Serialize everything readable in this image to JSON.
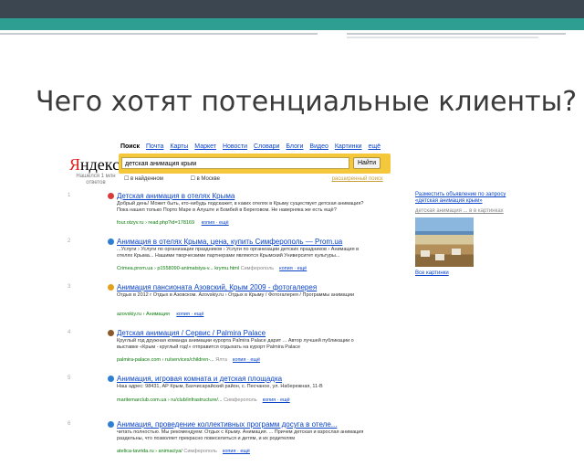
{
  "slide_title": "Чего хотят потенциальные клиенты?",
  "yandex": {
    "logo": "Яндекс",
    "found": "Нашёлся 1 млн ответов",
    "services": [
      "Поиск",
      "Почта",
      "Карты",
      "Маркет",
      "Новости",
      "Словари",
      "Блоги",
      "Видео",
      "Картинки",
      "ещё"
    ],
    "query": "детская анимация крым",
    "search_button": "Найти",
    "option1": "в найденном",
    "option2": "в Москве",
    "advanced": "расширенный поиск"
  },
  "results": [
    {
      "num": "1",
      "title": "Детская анимация в отелях Крыма",
      "snippet": "Добрый день! Может быть, кто-нибудь подскажет, в каких отелях в Крыму существует детская анимация? Пока нашел только Порто Маре в Алуште и Бомбей в Береговом. Не наверняка же есть ещё?",
      "url": "four.otzyv.ru › read.php?id=178169",
      "links": "копия · ещё",
      "fav": "#d83b3b"
    },
    {
      "num": "2",
      "title": "Анимация в отелях Крыма, цена, купить Симферополь — Prom.ua",
      "snippet": "...Услуги › Услуги по организации праздников › Услуги по организации детских праздников › Анимация в отелях Крыма... Нашими творческими партнерами являются Крымский Университет культуры...",
      "url": "Crimea.prom.ua › p1558090-animatsiya-v... krymu.html",
      "sub": "Симферополь",
      "links": "копия · ещё",
      "fav": "#2e7fd1"
    },
    {
      "num": "3",
      "title": "Анимация пансионата Азовский, Крым 2009 - фотогалерея",
      "snippet": "Отдых в 2012 г Отдых в Азовском. Azovskiy.ru › Отдых в Крыму / Фотогалерея / Программы анимации",
      "url": "azovskiy.ru › Анимация",
      "links": "копия · ещё",
      "fav": "#e3a01c"
    },
    {
      "num": "4",
      "title": "Детская анимация / Сервис / Palmira Palace",
      "snippet": "Круглый год дружная команда анимации курорта Palmira Palace дарит ... Автор лучшей публикации о выставке «Крым - круглый год!» отправится отдыхать на курорт Palmira Palace",
      "url": "palmira-palace.com › ru/services/children-...",
      "sub": "Ялта",
      "links": "копия · ещё",
      "fav": "#8a5a2a"
    },
    {
      "num": "5",
      "title": "Анимация, игровая комната и детская площадка",
      "snippet": "Наш адрес: 98431, АР Крым, Бахчисарайский район, с. Песчаное, ул. Набережная, 11-В",
      "url": "maritemarclub.com.ua › ru/club/infrastructure/...",
      "sub": "Симферополь",
      "links": "копия · ещё",
      "fav": "#2e7fd1"
    },
    {
      "num": "6",
      "title": "Анимация, проведение коллективных программ досуга в отеле...",
      "snippet": "читать полностью. Мы рекомендуем: Отдых с Крыму. Анимация. ... Причем детская и взрослая анимация раздельны, что позволяет прекрасно повеселиться и детям, и их родителям",
      "url": "atelica-tavrida.ru › animaciya/",
      "sub": "Симферополь",
      "links": "копия · ещё",
      "fav": "#2e7fd1"
    }
  ],
  "sidebar": {
    "ad_text": "Разместить объявление по запросу «детская анимация крым»",
    "sub_text": "детская анимация ... в в картинках",
    "all_images": "Все картинки"
  }
}
